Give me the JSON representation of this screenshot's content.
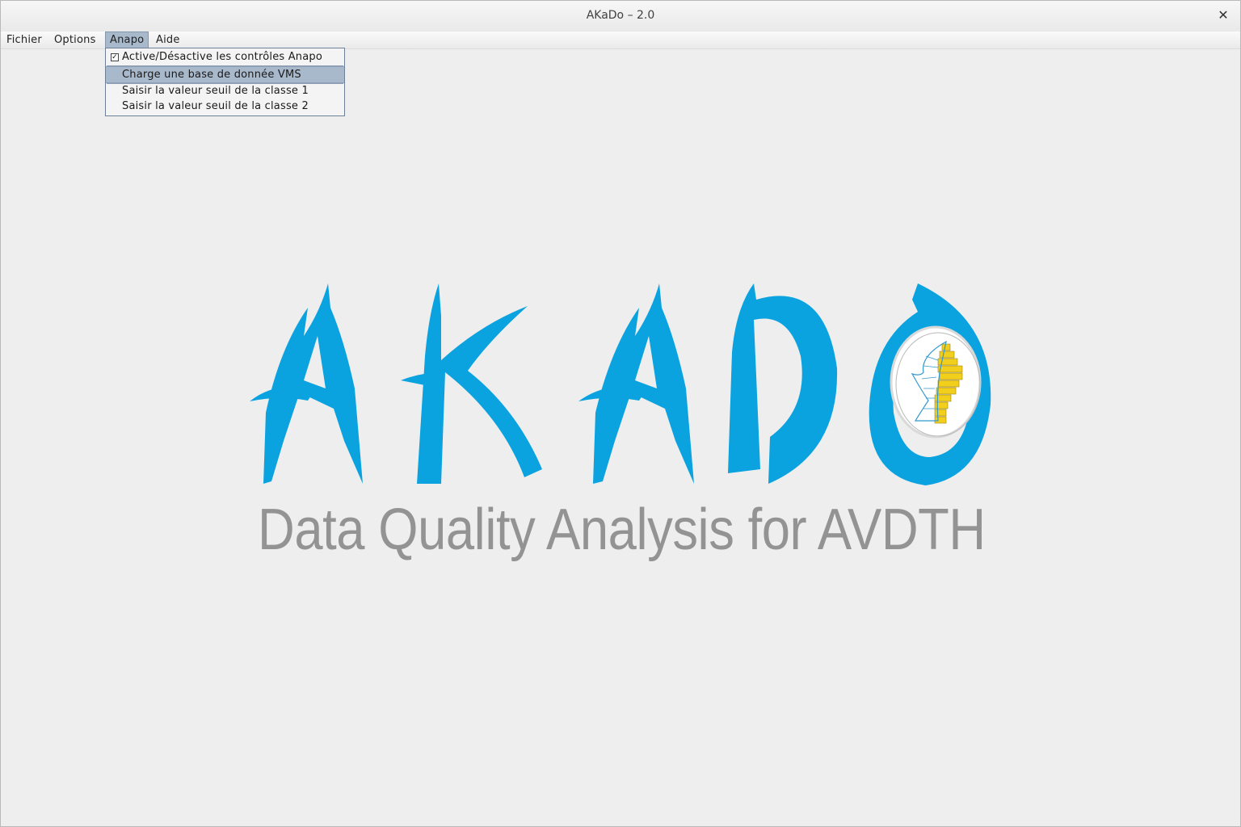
{
  "window": {
    "title": "AKaDo – 2.0",
    "close_glyph": "✕"
  },
  "menubar": {
    "items": [
      {
        "label": "Fichier"
      },
      {
        "label": "Options"
      },
      {
        "label": "Anapo",
        "active": true
      },
      {
        "label": "Aide"
      }
    ]
  },
  "anapo_menu": {
    "items": [
      {
        "label": "Active/Désactive les contrôles Anapo",
        "checked": true
      },
      {
        "label": "Charge une base de donnée VMS",
        "highlighted": true
      },
      {
        "label": "Saisir la valeur seuil de la classe 1"
      },
      {
        "label": "Saisir la valeur seuil de la classe 2"
      }
    ]
  },
  "splash": {
    "logo_text": "AKADO",
    "subtitle": "Data Quality Analysis for AVDTH",
    "colors": {
      "logo_blue": "#0aa3e0",
      "subtitle_gray": "#939393",
      "emblem_yellow": "#f2cf1a"
    }
  }
}
